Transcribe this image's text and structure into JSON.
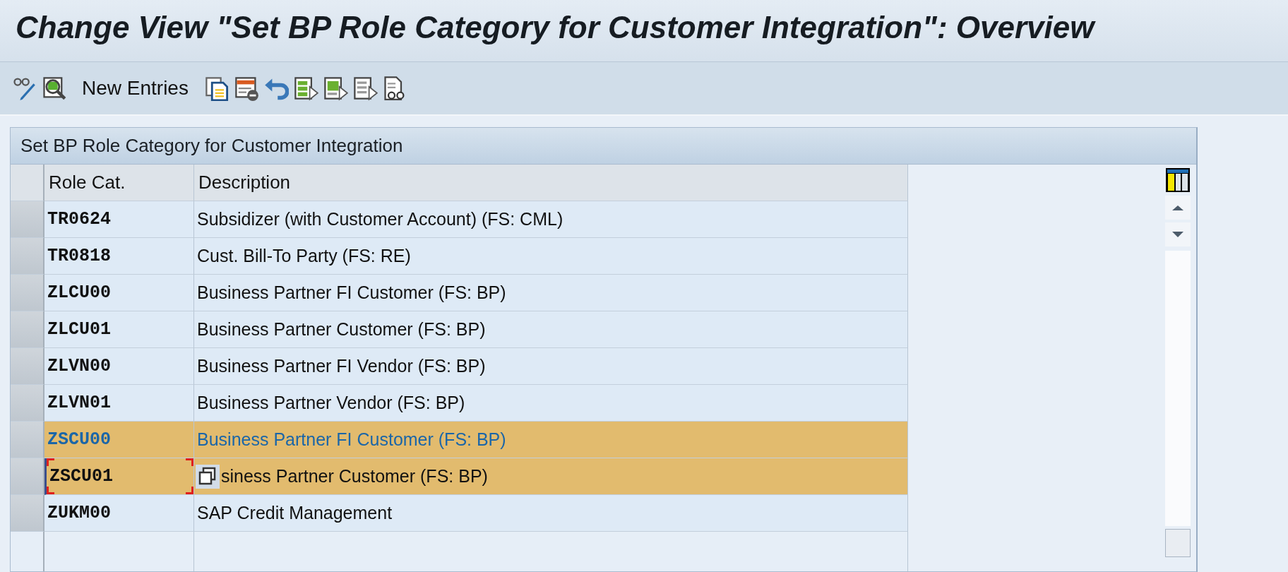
{
  "window": {
    "title": "Change View \"Set BP Role Category for Customer Integration\": Overview"
  },
  "toolbar": {
    "new_entries": "New Entries"
  },
  "panel": {
    "title": "Set BP Role Category for Customer Integration",
    "columns": [
      "Role Cat.",
      "Description"
    ],
    "rows": [
      {
        "role_cat": "TR0624",
        "description": "Subsidizer (with Customer Account) (FS: CML)",
        "selected": false,
        "lead": false,
        "focused": false
      },
      {
        "role_cat": "TR0818",
        "description": "Cust. Bill-To Party (FS: RE)",
        "selected": false,
        "lead": false,
        "focused": false
      },
      {
        "role_cat": "ZLCU00",
        "description": "Business Partner FI Customer (FS: BP)",
        "selected": false,
        "lead": false,
        "focused": false
      },
      {
        "role_cat": "ZLCU01",
        "description": "Business Partner Customer (FS: BP)",
        "selected": false,
        "lead": false,
        "focused": false
      },
      {
        "role_cat": "ZLVN00",
        "description": "Business Partner FI Vendor (FS: BP)",
        "selected": false,
        "lead": false,
        "focused": false
      },
      {
        "role_cat": "ZLVN01",
        "description": "Business Partner Vendor (FS: BP)",
        "selected": false,
        "lead": false,
        "focused": false
      },
      {
        "role_cat": "ZSCU00",
        "description": "Business Partner FI Customer (FS: BP)",
        "selected": true,
        "lead": true,
        "focused": false
      },
      {
        "role_cat": "ZSCU01",
        "description": "siness Partner Customer (FS: BP)",
        "selected": true,
        "lead": false,
        "focused": true
      },
      {
        "role_cat": "ZUKM00",
        "description": "SAP Credit Management",
        "selected": false,
        "lead": false,
        "focused": false
      }
    ]
  }
}
